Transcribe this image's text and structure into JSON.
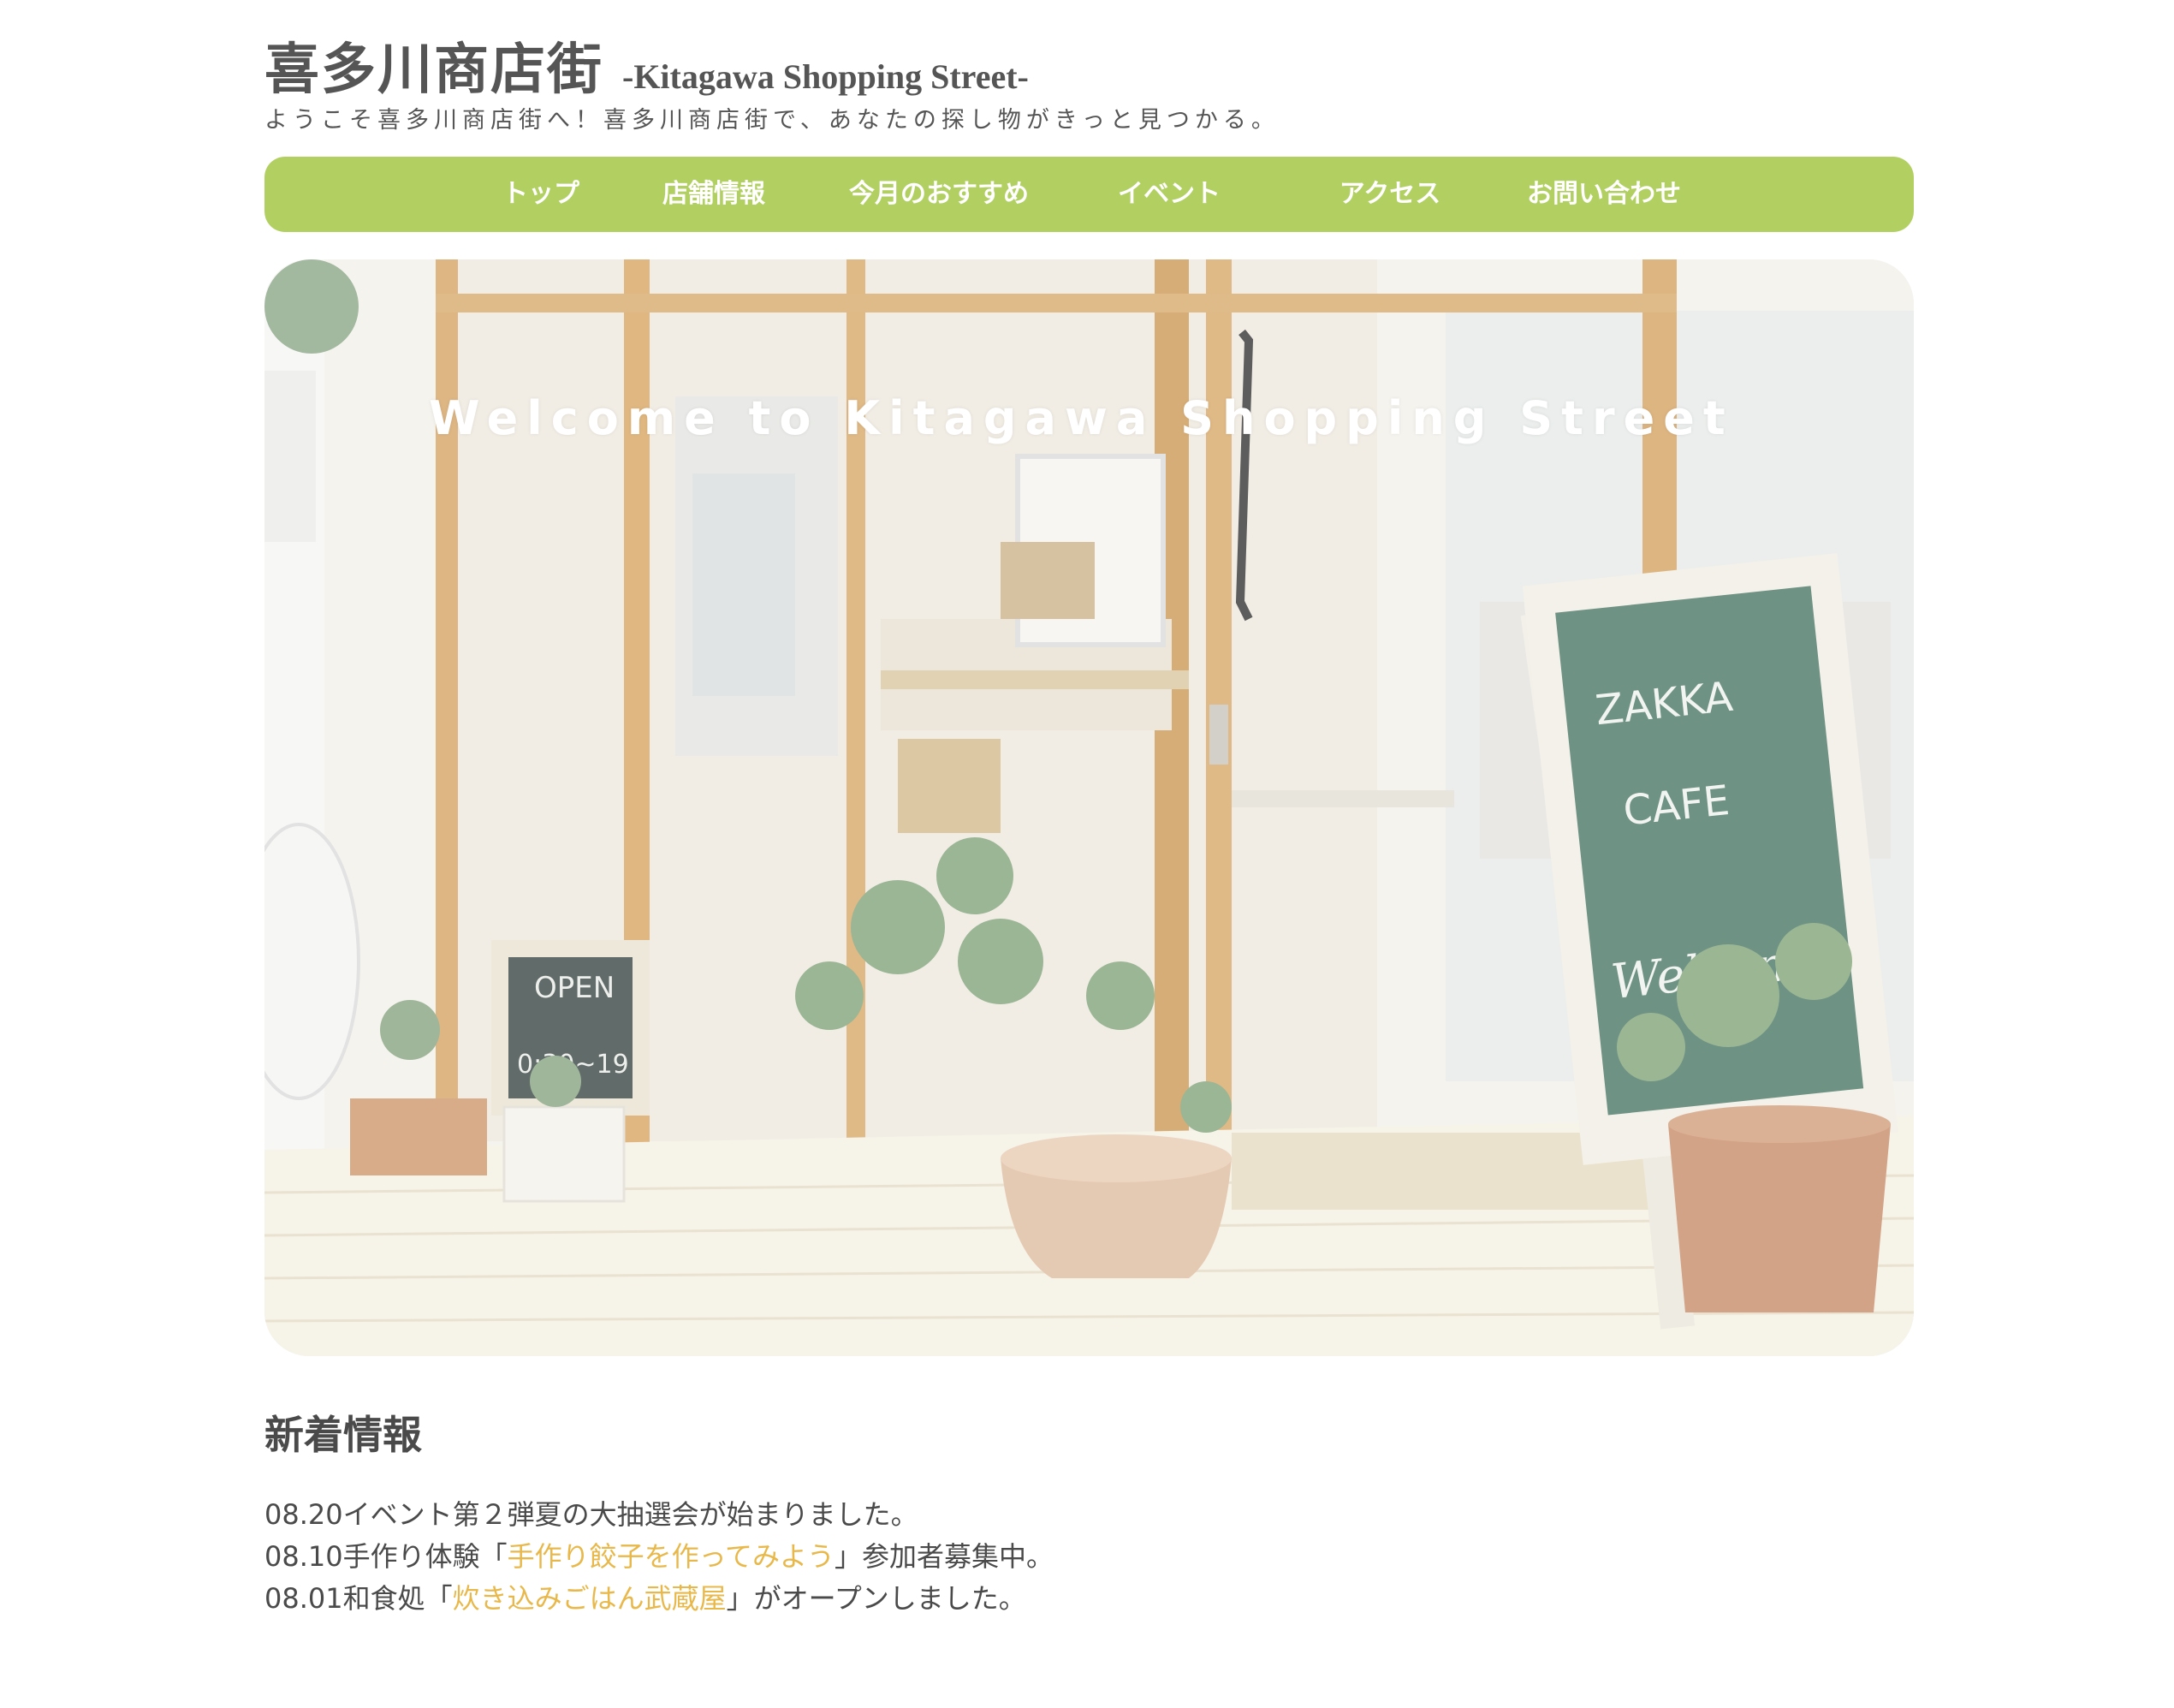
{
  "header": {
    "title": "喜多川商店街",
    "subtitle": "-Kitagawa Shopping Street-",
    "tagline": "ようこそ喜多川商店街へ！喜多川商店街で、あなたの探し物がきっと見つかる。"
  },
  "nav": {
    "items": [
      {
        "label": "トップ"
      },
      {
        "label": "店舗情報"
      },
      {
        "label": "今月のおすすめ"
      },
      {
        "label": "イベント"
      },
      {
        "label": "アクセス"
      },
      {
        "label": "お問い合わせ"
      }
    ]
  },
  "hero": {
    "heading": "Welcome to Kitagawa Shopping Street",
    "chalkboard_large": [
      "ZAKKA",
      "CAFE",
      "Welcome"
    ],
    "chalkboard_small": [
      "OPEN",
      "0:30~19"
    ]
  },
  "news": {
    "title": "新着情報",
    "items": [
      {
        "date": "08.20",
        "before": "イベント第２弾夏の大抽選会が始まりました。",
        "link": "",
        "after": ""
      },
      {
        "date": "08.10",
        "before": "手作り体験「",
        "link": "手作り餃子を作ってみよう",
        "after": "」参加者募集中。"
      },
      {
        "date": "08.01",
        "before": "和食処「",
        "link": "炊き込みごはん武蔵屋",
        "after": "」がオープンしました。"
      }
    ]
  },
  "colors": {
    "nav_bg": "#b2d062",
    "link": "#e8b84a",
    "text": "#4a4a4a"
  }
}
